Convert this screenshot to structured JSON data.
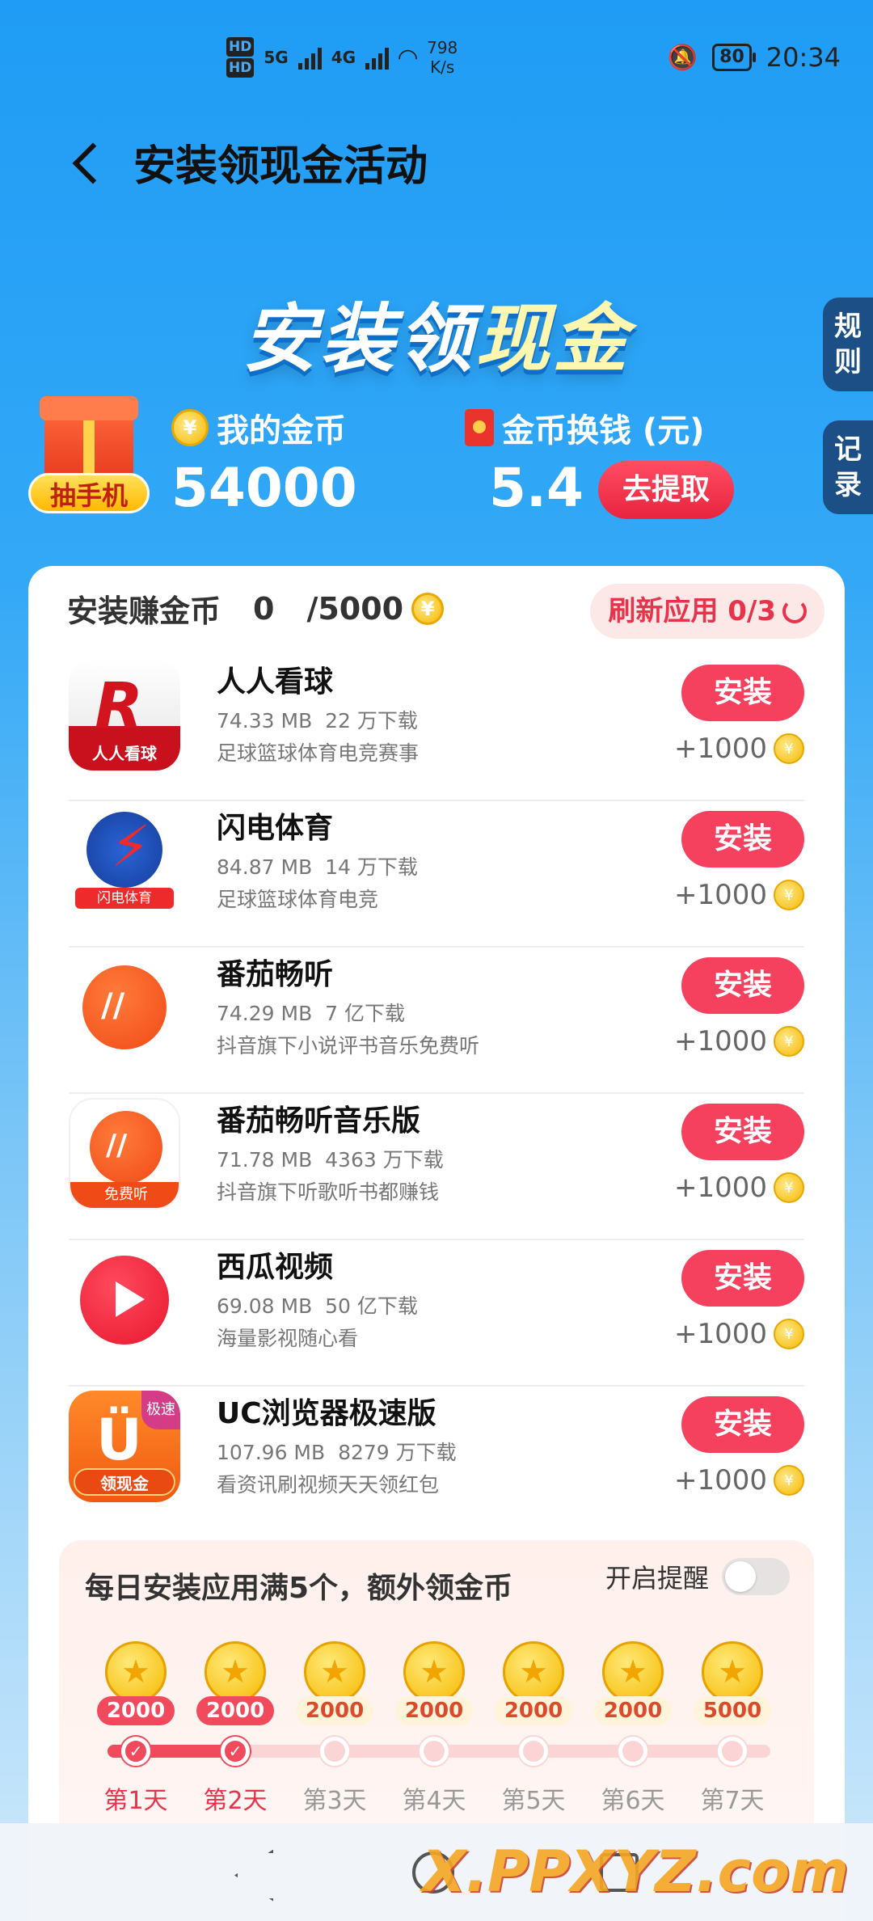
{
  "status_bar": {
    "network_left": "5G",
    "network_right": "4G",
    "speed": "798",
    "speed_unit": "K/s",
    "battery": "80",
    "time": "20:34"
  },
  "header": {
    "title": "安装领现金活动"
  },
  "banner": {
    "title_part1": "安装领",
    "title_part2": "现金"
  },
  "side_tabs": {
    "rules": "规则",
    "records": "记录"
  },
  "gift": {
    "label": "抽手机"
  },
  "wallet": {
    "my_coins_label": "我的金币",
    "my_coins_value": "54000",
    "exchange_label": "金币换钱 (元)",
    "exchange_value": "5.4",
    "withdraw_label": "去提取"
  },
  "task": {
    "title": "安装赚金币",
    "current": "0",
    "total": "/5000",
    "refresh_label": "刷新应用 0/3"
  },
  "apps": [
    {
      "name": "人人看球",
      "size": "74.33 MB",
      "downloads": "22 万下载",
      "desc": "足球篮球体育电竞赛事",
      "button": "安装",
      "reward": "+1000"
    },
    {
      "name": "闪电体育",
      "size": "84.87 MB",
      "downloads": "14 万下载",
      "desc": "足球篮球体育电竞",
      "button": "安装",
      "reward": "+1000"
    },
    {
      "name": "番茄畅听",
      "size": "74.29 MB",
      "downloads": "7 亿下载",
      "desc": "抖音旗下小说评书音乐免费听",
      "button": "安装",
      "reward": "+1000"
    },
    {
      "name": "番茄畅听音乐版",
      "size": "71.78 MB",
      "downloads": "4363 万下载",
      "desc": "抖音旗下听歌听书都赚钱",
      "button": "安装",
      "reward": "+1000"
    },
    {
      "name": "西瓜视频",
      "size": "69.08 MB",
      "downloads": "50 亿下载",
      "desc": "海量影视随心看",
      "button": "安装",
      "reward": "+1000"
    },
    {
      "name": "UC浏览器极速版",
      "size": "107.96 MB",
      "downloads": "8279 万下载",
      "desc": "看资讯刷视频天天领红包",
      "button": "安装",
      "reward": "+1000"
    }
  ],
  "app_icon_labels": {
    "rrkq": "人人看球",
    "sdty": "闪电体育",
    "fqmusic": "免费听",
    "uc_corner": "极速",
    "uc": "领现金"
  },
  "daily": {
    "title": "每日安装应用满5个，额外领金币",
    "remind_label": "开启提醒",
    "remind_on": false,
    "days": [
      {
        "amount": "2000",
        "label": "第1天",
        "done": true
      },
      {
        "amount": "2000",
        "label": "第2天",
        "done": true
      },
      {
        "amount": "2000",
        "label": "第3天",
        "done": false
      },
      {
        "amount": "2000",
        "label": "第4天",
        "done": false
      },
      {
        "amount": "2000",
        "label": "第5天",
        "done": false
      },
      {
        "amount": "2000",
        "label": "第6天",
        "done": false
      },
      {
        "amount": "5000",
        "label": "第7天",
        "done": false
      }
    ]
  },
  "watermark": "X.PPXYZ.com",
  "colors": {
    "accent": "#f5405e",
    "background": "#1f9cf5",
    "coin": "#f5b800"
  }
}
